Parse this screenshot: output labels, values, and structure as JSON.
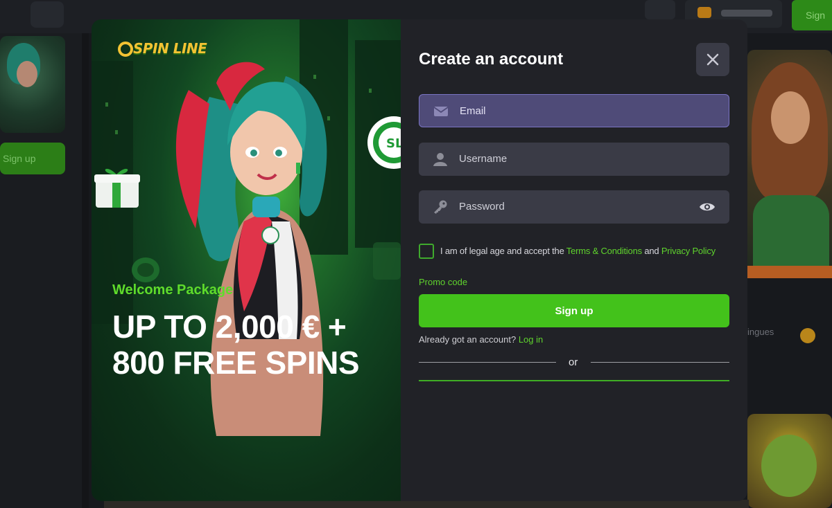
{
  "background": {
    "left_signup_label": "Sign up",
    "right_signup_label": "Sign",
    "right_row_label": "ingues"
  },
  "promo": {
    "logo_text": "SPIN LINE",
    "kicker": "Welcome Package",
    "headline": "UP TO 2,000 € + 800 FREE SPINS"
  },
  "form": {
    "title": "Create an account",
    "email_placeholder": "Email",
    "username_placeholder": "Username",
    "password_placeholder": "Password",
    "legal_prefix": "I am of legal age and accept the ",
    "terms_link": "Terms & Conditions",
    "legal_and": " and ",
    "privacy_link": "Privacy Policy",
    "promo_code_link": "Promo code",
    "signup_label": "Sign up",
    "already_text": "Already got an account? ",
    "login_link": "Log in",
    "or_text": "or"
  },
  "colors": {
    "accent_green": "#43c21b",
    "link_green": "#5fd32d",
    "panel_bg": "#212227",
    "field_bg": "#3a3b46",
    "field_active_bg": "#4f4b78"
  },
  "icons": [
    "close-icon",
    "email-icon",
    "user-icon",
    "key-icon",
    "eye-icon",
    "checkbox"
  ]
}
